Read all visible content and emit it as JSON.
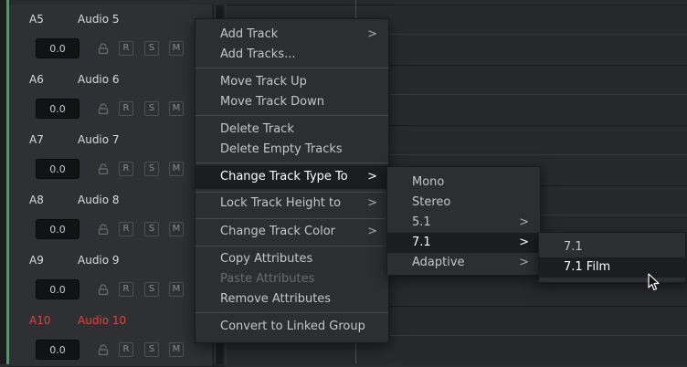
{
  "tracks": [
    {
      "id": "A5",
      "name": "Audio 5",
      "volume": "0.0",
      "red": false
    },
    {
      "id": "A6",
      "name": "Audio 6",
      "volume": "0.0",
      "red": false
    },
    {
      "id": "A7",
      "name": "Audio 7",
      "volume": "0.0",
      "red": false
    },
    {
      "id": "A8",
      "name": "Audio 8",
      "volume": "0.0",
      "red": false
    },
    {
      "id": "A9",
      "name": "Audio 9",
      "volume": "0.0",
      "red": false
    },
    {
      "id": "A10",
      "name": "Audio 10",
      "volume": "0.0",
      "red": true
    }
  ],
  "track_buttons": {
    "record": "R",
    "solo": "S",
    "mute": "M"
  },
  "context_menu": {
    "add_track": "Add Track",
    "add_tracks": "Add Tracks...",
    "move_up": "Move Track Up",
    "move_down": "Move Track Down",
    "delete_track": "Delete Track",
    "delete_empty": "Delete Empty Tracks",
    "change_type": "Change Track Type To",
    "lock_height": "Lock Track Height to",
    "change_color": "Change Track Color",
    "copy_attr": "Copy Attributes",
    "paste_attr": "Paste Attributes",
    "remove_attr": "Remove Attributes",
    "convert_linked": "Convert to Linked Group"
  },
  "type_submenu": {
    "mono": "Mono",
    "stereo": "Stereo",
    "five_one": "5.1",
    "seven_one": "7.1",
    "adaptive": "Adaptive"
  },
  "seven_one_submenu": {
    "seven_one": "7.1",
    "seven_one_film": "7.1 Film"
  },
  "glyphs": {
    "submenu_arrow": ">"
  },
  "colors": {
    "accent_green": "#3aa865",
    "record_red": "#e0443a",
    "playhead": "#b3261e"
  }
}
